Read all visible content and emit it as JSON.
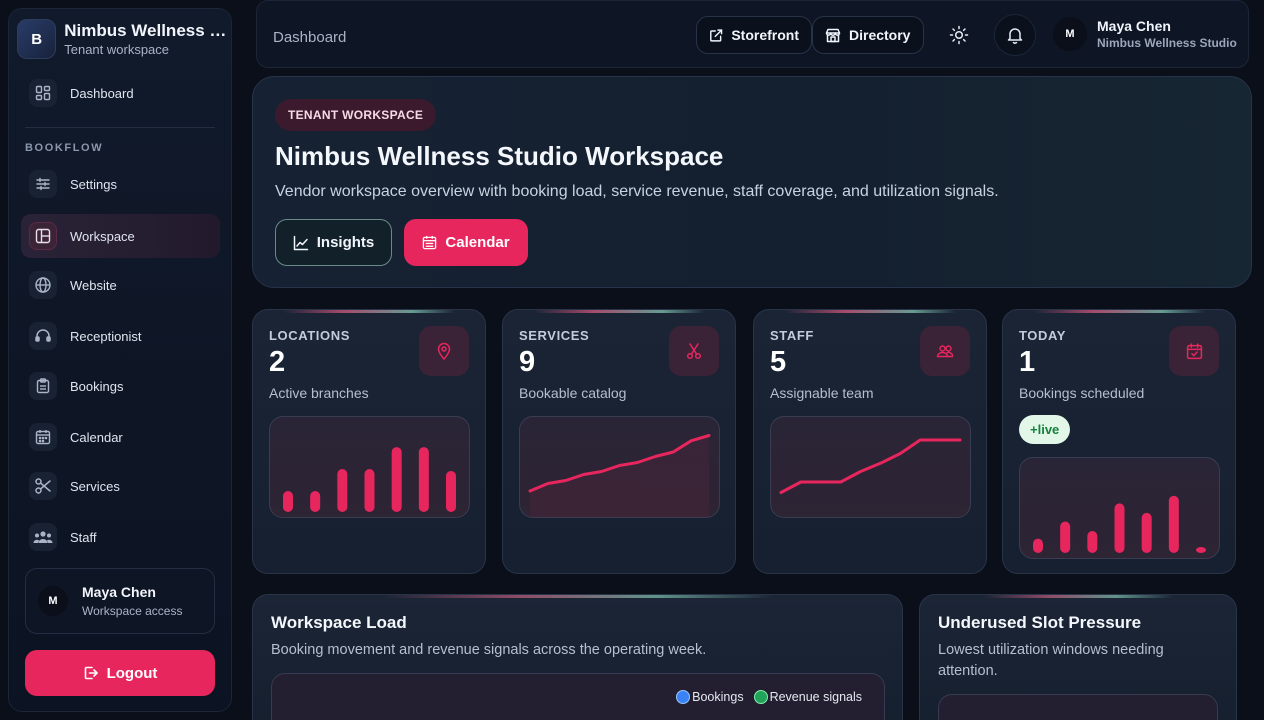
{
  "brand": {
    "logo_letter": "B",
    "name": "Nimbus Wellness Studio",
    "subtitle": "Tenant workspace"
  },
  "sidebar": {
    "items": [
      {
        "label": "Dashboard",
        "icon": "dashboard-icon"
      },
      {
        "label": "Settings",
        "icon": "sliders-icon"
      },
      {
        "label": "Workspace",
        "icon": "layout-icon",
        "active": true
      },
      {
        "label": "Website",
        "icon": "globe-icon"
      },
      {
        "label": "Receptionist",
        "icon": "headset-icon"
      },
      {
        "label": "Bookings",
        "icon": "clipboard-icon"
      },
      {
        "label": "Calendar",
        "icon": "calendar-icon"
      },
      {
        "label": "Services",
        "icon": "scissors-icon"
      },
      {
        "label": "Staff",
        "icon": "team-icon"
      }
    ],
    "section_label": "BOOKFLOW",
    "user": {
      "initial": "M",
      "name": "Maya Chen",
      "role": "Workspace access"
    },
    "logout_label": "Logout"
  },
  "topbar": {
    "breadcrumb": "Dashboard",
    "storefront_label": "Storefront",
    "directory_label": "Directory",
    "user": {
      "initial": "M",
      "name": "Maya Chen",
      "org": "Nimbus Wellness Studio"
    }
  },
  "hero": {
    "badge": "TENANT WORKSPACE",
    "title": "Nimbus Wellness Studio Workspace",
    "description": "Vendor workspace overview with booking load, service revenue, staff coverage, and utilization signals.",
    "insights_label": "Insights",
    "calendar_label": "Calendar"
  },
  "stats": [
    {
      "label": "LOCATIONS",
      "value": "2",
      "sub": "Active branches",
      "icon": "map-pin-icon",
      "spark_type": "bar",
      "spark": [
        0.22,
        0.22,
        0.45,
        0.45,
        0.68,
        0.68,
        0.43
      ]
    },
    {
      "label": "SERVICES",
      "value": "9",
      "sub": "Bookable catalog",
      "icon": "scissors-icon",
      "spark_type": "area",
      "spark": [
        0.08,
        0.18,
        0.22,
        0.3,
        0.34,
        0.42,
        0.46,
        0.54,
        0.6,
        0.75,
        0.82
      ]
    },
    {
      "label": "STAFF",
      "value": "5",
      "sub": "Assignable team",
      "icon": "team-icon",
      "spark_type": "line",
      "spark": [
        0.06,
        0.2,
        0.2,
        0.2,
        0.34,
        0.45,
        0.58,
        0.76,
        0.76,
        0.76
      ]
    },
    {
      "label": "TODAY",
      "value": "1",
      "sub": "Bookings scheduled",
      "icon": "calendar-check-icon",
      "badge": "+live",
      "spark_type": "bar",
      "spark": [
        0.15,
        0.33,
        0.23,
        0.52,
        0.42,
        0.6,
        0.06
      ]
    }
  ],
  "workspace_load": {
    "title": "Workspace Load",
    "subtitle": "Booking movement and revenue signals across the operating week.",
    "legend": [
      {
        "label": "Bookings",
        "color": "#3b82f6"
      },
      {
        "label": "Revenue signals",
        "color": "#22a35a"
      }
    ]
  },
  "underused": {
    "title": "Underused Slot Pressure",
    "subtitle_line1": "Lowest utilization windows needing",
    "subtitle_line2": "attention."
  },
  "colors": {
    "accent": "#e8265e",
    "background": "#0a0f1a"
  }
}
